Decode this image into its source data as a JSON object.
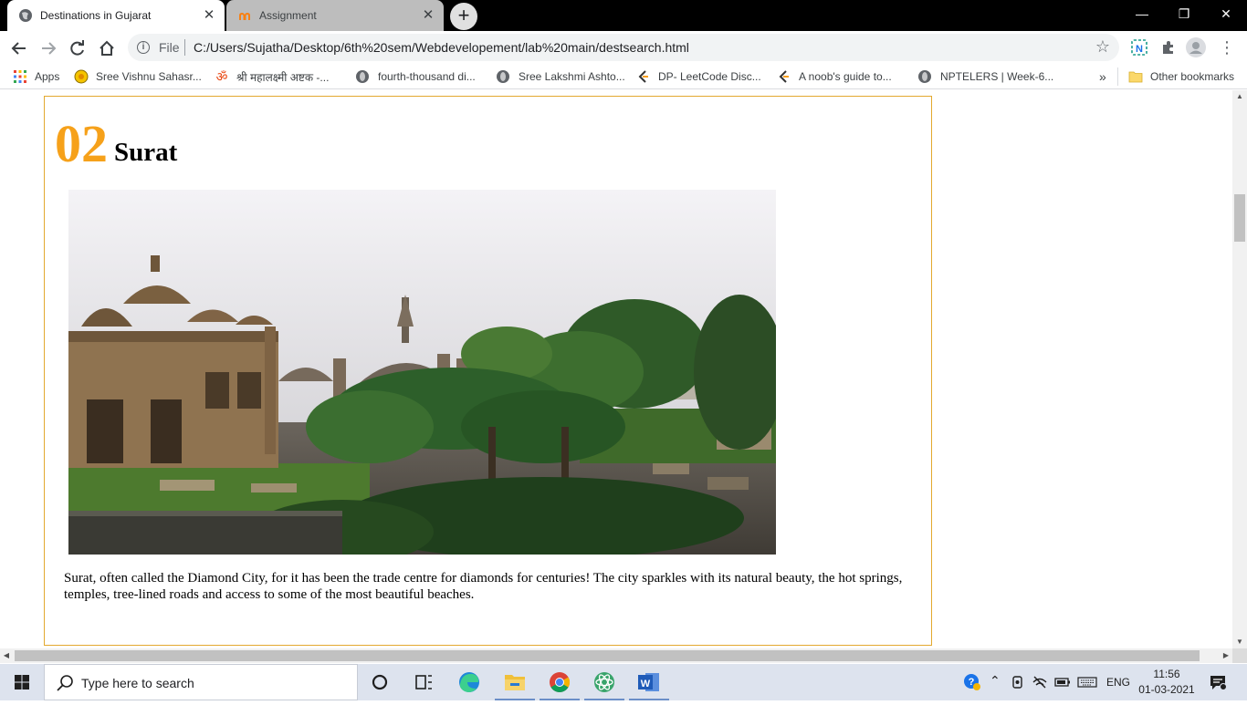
{
  "browser": {
    "tabs": [
      {
        "label": "Destinations in Gujarat",
        "active": true,
        "favicon": "globe-icon"
      },
      {
        "label": "Assignment",
        "active": false,
        "favicon": "moodle-icon"
      }
    ],
    "address": {
      "scheme_label": "File",
      "url": "C:/Users/Sujatha/Desktop/6th%20sem/Webdevelopement/lab%20main/destsearch.html"
    },
    "bookmarks": [
      {
        "label": "Apps",
        "icon": "apps-grid-icon"
      },
      {
        "label": "Sree Vishnu Sahasr...",
        "icon": "sun-icon"
      },
      {
        "label": "श्री महालक्ष्मी अष्टक -...",
        "icon": "om-icon"
      },
      {
        "label": "fourth-thousand di...",
        "icon": "globe-icon"
      },
      {
        "label": "Sree Lakshmi Ashto...",
        "icon": "globe-icon"
      },
      {
        "label": "DP- LeetCode Disc...",
        "icon": "leetcode-icon"
      },
      {
        "label": "A noob's guide to...",
        "icon": "leetcode-icon"
      },
      {
        "label": "NPTELERS | Week-6...",
        "icon": "globe-icon"
      }
    ],
    "overflow_label": "»",
    "other_bookmarks": "Other bookmarks"
  },
  "page": {
    "destination_number": "02",
    "destination_name": "Surat",
    "description": "Surat, often called the Diamond City, for it has been the trade centre for diamonds for centuries! The city sparkles with its natural beauty, the hot springs, temples, tree-lined roads and access to some of the most beautiful beaches.",
    "accent_color": "#f6a11a",
    "border_color": "#e3a92f"
  },
  "taskbar": {
    "search_placeholder": "Type here to search",
    "language": "ENG",
    "time": "11:56",
    "date": "01-03-2021"
  }
}
